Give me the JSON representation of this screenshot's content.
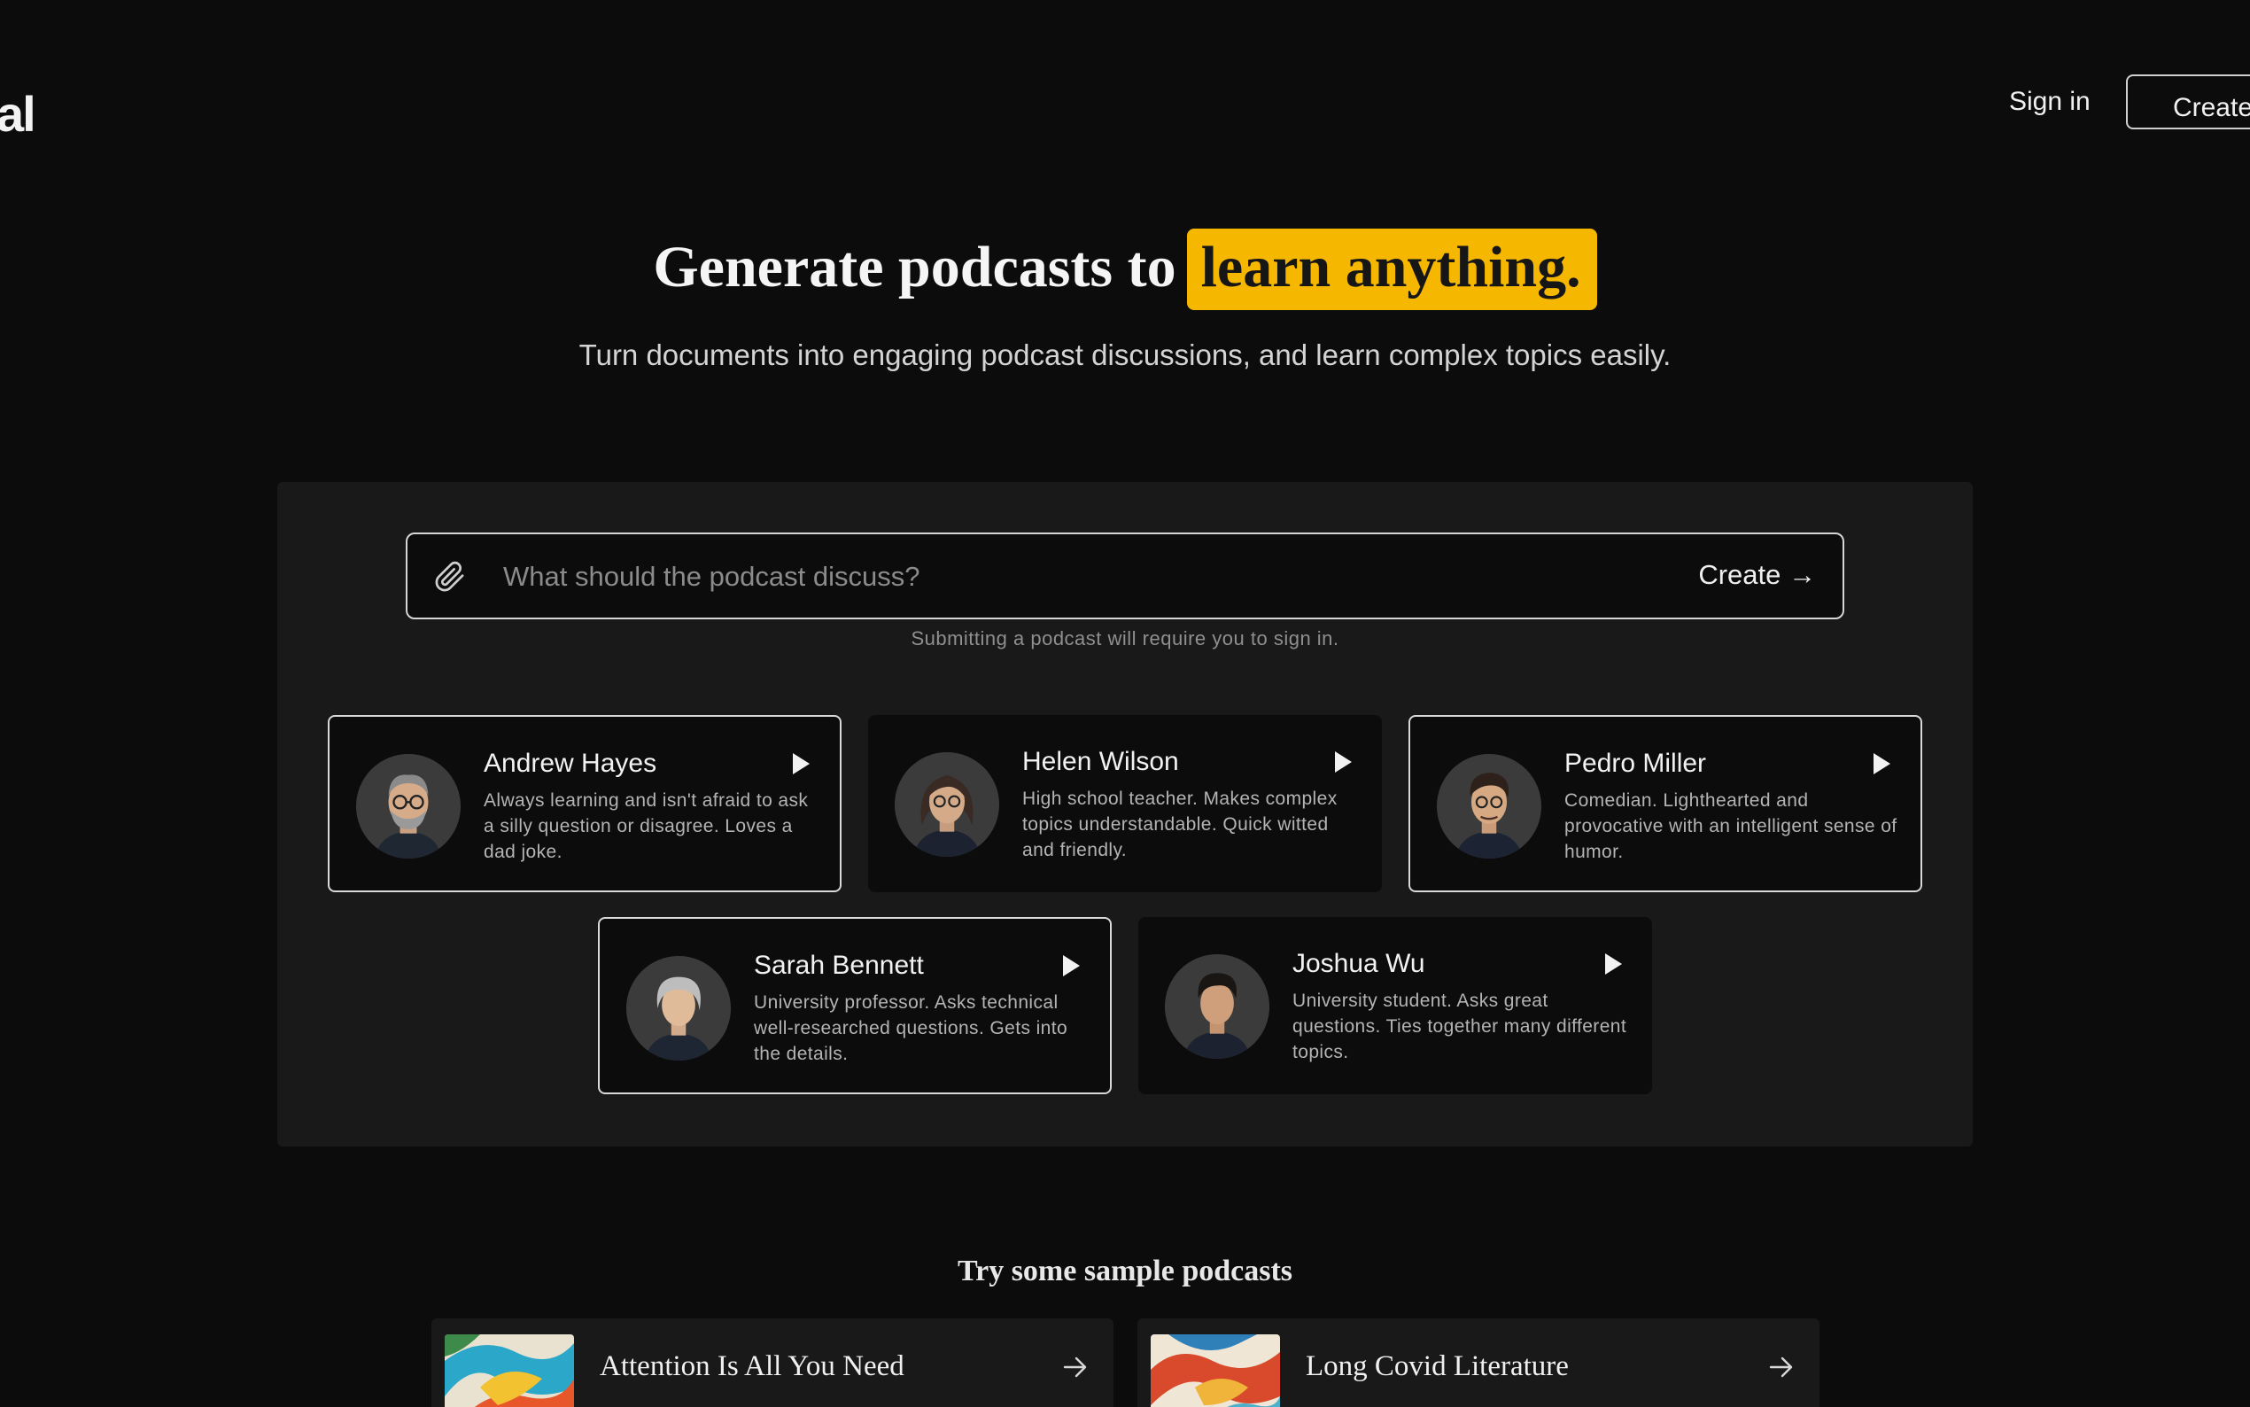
{
  "header": {
    "logo": "al",
    "sign_in": "Sign in",
    "create_account": "Create ac"
  },
  "hero": {
    "title_prefix": "Generate podcasts to",
    "title_highlight": "learn anything.",
    "subtitle": "Turn documents into engaging podcast discussions, and learn complex topics easily.",
    "highlight_color": "#f5b700"
  },
  "prompt": {
    "placeholder": "What should the podcast discuss?",
    "value": "",
    "create_label": "Create →",
    "note": "Submitting a podcast will require you to sign in."
  },
  "hosts": [
    {
      "name": "Andrew Hayes",
      "description": "Always learning and isn't afraid to ask a silly question or disagree. Loves a dad joke.",
      "selected": true
    },
    {
      "name": "Helen Wilson",
      "description": "High school teacher. Makes complex topics understandable. Quick witted and friendly.",
      "selected": false
    },
    {
      "name": "Pedro Miller",
      "description": "Comedian. Lighthearted and provocative with an intelligent sense of humor.",
      "selected": true
    },
    {
      "name": "Sarah Bennett",
      "description": "University professor. Asks technical well-researched questions. Gets into the details.",
      "selected": true
    },
    {
      "name": "Joshua Wu",
      "description": "University student. Asks great questions. Ties together many different topics.",
      "selected": false
    }
  ],
  "samples": {
    "title": "Try some sample podcasts",
    "items": [
      {
        "title": "Attention Is All You Need"
      },
      {
        "title": "Long Covid Literature"
      }
    ]
  },
  "icons": {
    "attach": "paperclip-icon",
    "play": "play-icon",
    "arrow": "arrow-right-icon"
  }
}
